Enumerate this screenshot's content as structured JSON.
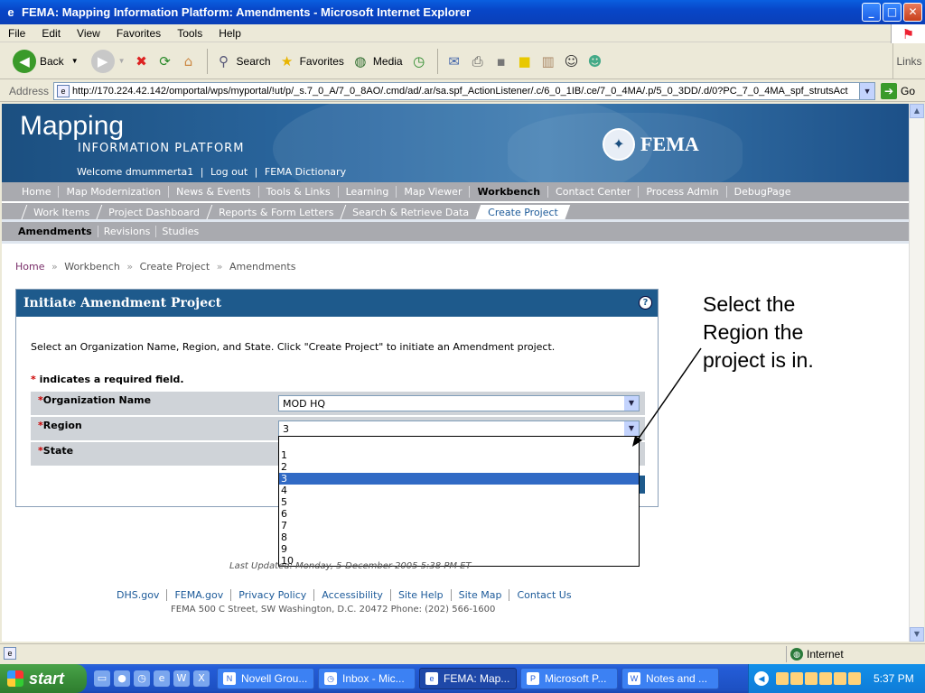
{
  "window": {
    "title": "FEMA: Mapping Information Platform: Amendments - Microsoft Internet Explorer",
    "minimize": "_",
    "maximize": "□",
    "close": "✕"
  },
  "menubar": [
    "File",
    "Edit",
    "View",
    "Favorites",
    "Tools",
    "Help"
  ],
  "toolbar": {
    "back": "Back",
    "search": "Search",
    "favorites": "Favorites",
    "media": "Media",
    "links": "Links"
  },
  "address": {
    "label": "Address",
    "url": "http://170.224.42.142/omportal/wps/myportal/!ut/p/_s.7_0_A/7_0_8AO/.cmd/ad/.ar/sa.spf_ActionListener/.c/6_0_1IB/.ce/7_0_4MA/.p/5_0_3DD/.d/0?PC_7_0_4MA_spf_strutsAct",
    "go": "Go"
  },
  "banner": {
    "title": "Mapping",
    "subtitle": "INFORMATION PLATFORM",
    "welcome": "Welcome dmummerta1",
    "logout": "Log out",
    "dictionary": "FEMA Dictionary",
    "sep": "|",
    "fema": "FEMA"
  },
  "nav1": [
    "Home",
    "Map Modernization",
    "News & Events",
    "Tools & Links",
    "Learning",
    "Map Viewer",
    "Workbench",
    "Contact Center",
    "Process Admin",
    "DebugPage"
  ],
  "nav2": [
    "Work Items",
    "Project Dashboard",
    "Reports & Form Letters",
    "Search & Retrieve Data",
    "Create Project"
  ],
  "nav3": [
    "Amendments",
    "Revisions",
    "Studies"
  ],
  "breadcrumb": {
    "home": "Home",
    "sep": "»",
    "workbench": "Workbench",
    "create": "Create Project",
    "current": "Amendments"
  },
  "panel": {
    "title": "Initiate Amendment Project",
    "help": "?",
    "instructions": "Select an Organization Name, Region, and State. Click \"Create Project\" to initiate an Amendment project.",
    "required_star": "*",
    "required_note": " indicates a required field.",
    "fields": {
      "org_label": "Organization Name",
      "org_value": "MOD HQ",
      "region_label": "Region",
      "region_value": "3",
      "state_label": "State"
    }
  },
  "region_options": [
    "",
    "1",
    "2",
    "3",
    "4",
    "5",
    "6",
    "7",
    "8",
    "9",
    "10"
  ],
  "selected_region": "3",
  "footer": {
    "last_updated": "Last Updated: Monday, 5-December-2005 5:38 PM ET",
    "links": [
      "DHS.gov",
      "FEMA.gov",
      "Privacy Policy",
      "Accessibility",
      "Site Help",
      "Site Map",
      "Contact Us"
    ],
    "address": "FEMA 500 C Street, SW Washington, D.C. 20472 Phone: (202) 566-1600"
  },
  "callout": "Select the\nRegion the\nproject is in.",
  "statusbar": {
    "zone": "Internet"
  },
  "taskbar": {
    "start": "start",
    "tasks": [
      "Novell Grou...",
      "Inbox - Mic...",
      "FEMA: Map...",
      "Microsoft P...",
      "Notes and ..."
    ],
    "clock": "5:37 PM"
  },
  "colors": {
    "panel_header": "#1e5a8c",
    "nav_gray": "#a9aaaf",
    "selected_option": "#316ac5",
    "required_star": "#cc0000"
  }
}
